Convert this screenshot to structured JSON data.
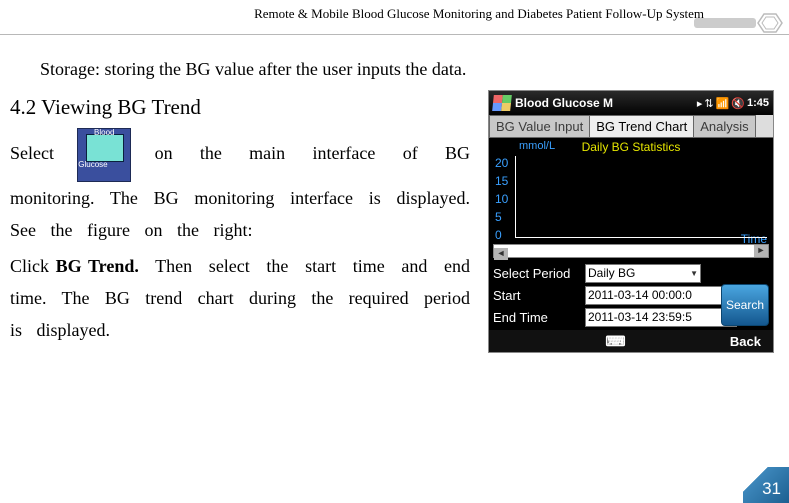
{
  "header": {
    "title": "Remote & Mobile Blood Glucose Monitoring and Diabetes Patient Follow-Up System"
  },
  "body": {
    "storage_line": "Storage: storing the BG value after the user inputs the data.",
    "heading": "4.2 Viewing BG Trend",
    "icon_label": "Blood Glucose",
    "p1_before": "Select",
    "p1_after": "on the main interface of BG monitoring. The BG monitoring interface is displayed. See the figure on the right:",
    "p2_before": "Click ",
    "p2_bold": "BG Trend.",
    "p2_after": " Then select the start time and end time. The BG trend chart during the required period is displayed."
  },
  "device": {
    "title": "Blood Glucose M",
    "clock": "1:45",
    "tabs": {
      "value_input": "BG Value Input",
      "trend": "BG Trend Chart",
      "analysis": "Analysis"
    },
    "chart": {
      "title": "Daily BG Statistics",
      "y_unit": "mmol/L",
      "x_label": "Time",
      "yticks": [
        "20",
        "15",
        "10",
        "5",
        "0"
      ]
    },
    "controls": {
      "period_label": "Select Period",
      "period_value": "Daily BG",
      "start_label": "Start",
      "start_value": "2011-03-14 00:00:0",
      "end_label": "End Time",
      "end_value": "2011-03-14 23:59:5",
      "search": "Search"
    },
    "softkeys": {
      "keyboard": "⌨",
      "back": "Back"
    }
  },
  "page_number": "31",
  "chart_data": {
    "type": "bar",
    "title": "Daily BG Statistics",
    "xlabel": "Time",
    "ylabel": "mmol/L",
    "ylim": [
      0,
      20
    ],
    "yticks": [
      0,
      5,
      10,
      15,
      20
    ],
    "categories": [],
    "values": []
  }
}
